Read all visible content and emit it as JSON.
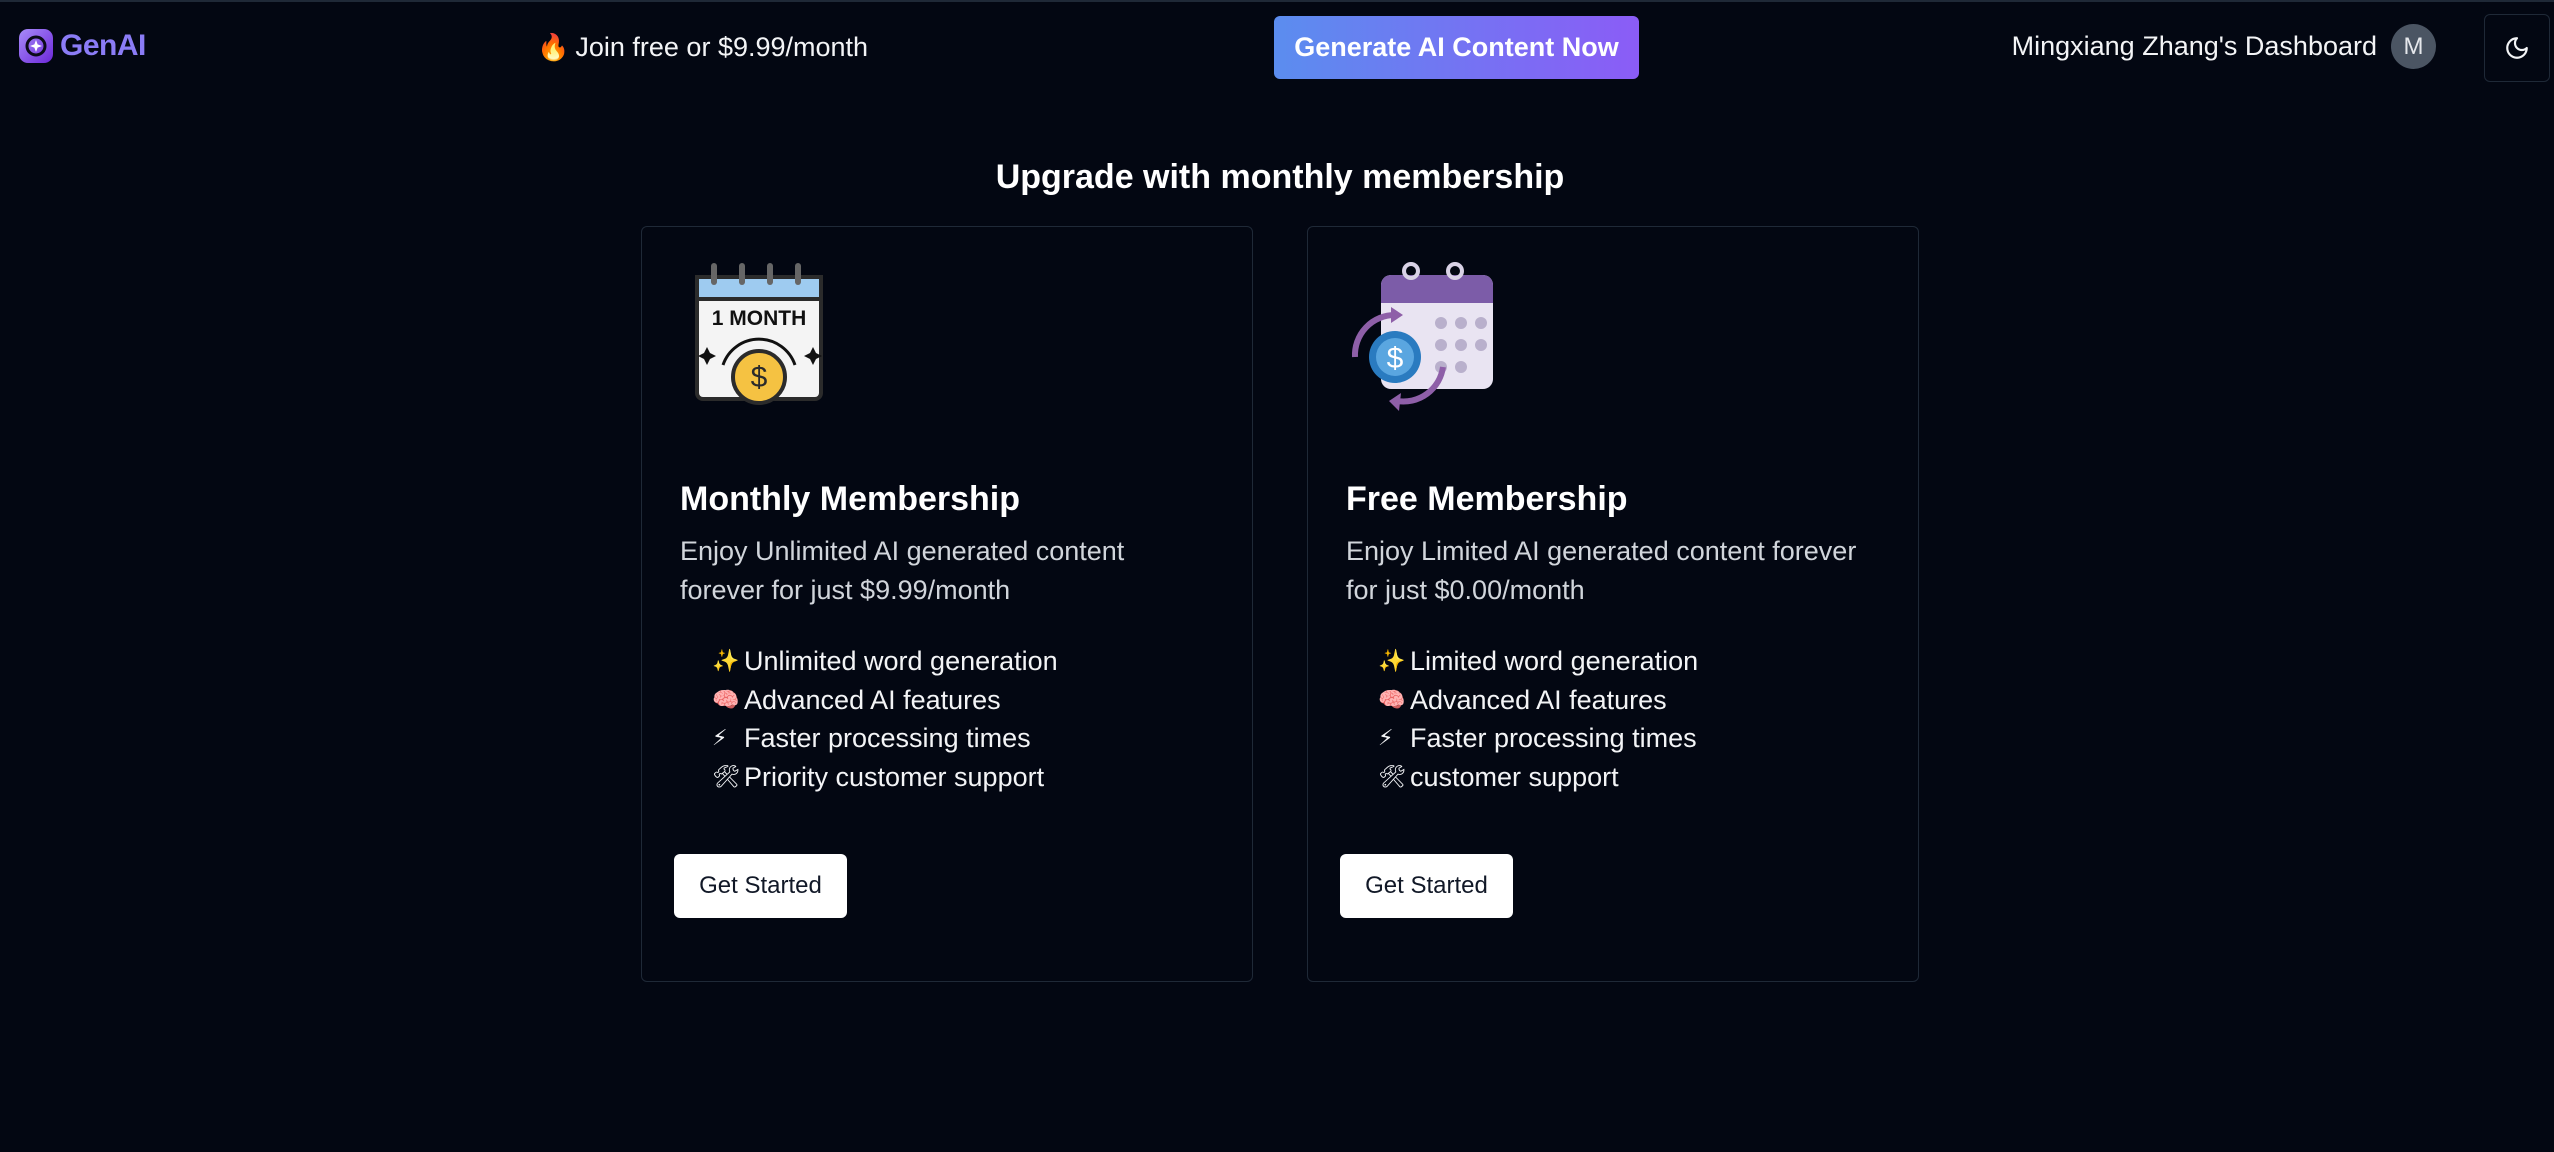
{
  "brand": {
    "name": "GenAI",
    "logo_icon": "genai-logo-icon",
    "accent": "#8b7cf6"
  },
  "header": {
    "promo_icon": "🔥",
    "promo_text": "Join free or $9.99/month",
    "cta_label": "Generate AI Content Now",
    "cta_gradient": [
      "#5b8def",
      "#8b5cf6"
    ],
    "user_label": "Mingxiang Zhang's Dashboard",
    "avatar_initial": "M",
    "theme_toggle_icon": "moon-icon"
  },
  "main": {
    "title": "Upgrade with monthly membership",
    "plans": [
      {
        "illustration": "calendar-month-coin-illustration",
        "illustration_text": "1 MONTH",
        "title": "Monthly Membership",
        "description": "Enjoy Unlimited AI generated content forever for just $9.99/month",
        "features": [
          {
            "icon": "✨",
            "text": "Unlimited word generation"
          },
          {
            "icon": "🧠",
            "text": "Advanced AI features"
          },
          {
            "icon": "⚡",
            "text": "Faster processing times"
          },
          {
            "icon": "🛠",
            "text": "Priority customer support"
          }
        ],
        "button_label": "Get Started"
      },
      {
        "illustration": "calendar-recurring-payment-illustration",
        "title": "Free Membership",
        "description": "Enjoy Limited AI generated content forever for just $0.00/month",
        "features": [
          {
            "icon": "✨",
            "text": "Limited word generation"
          },
          {
            "icon": "🧠",
            "text": "Advanced AI features"
          },
          {
            "icon": "⚡",
            "text": "Faster processing times"
          },
          {
            "icon": "🛠",
            "text": "customer support"
          }
        ],
        "button_label": "Get Started"
      }
    ]
  },
  "colors": {
    "background": "#030712",
    "card_border": "#1f2937",
    "text": "#f9fafb",
    "muted_text": "#d1d5db"
  }
}
